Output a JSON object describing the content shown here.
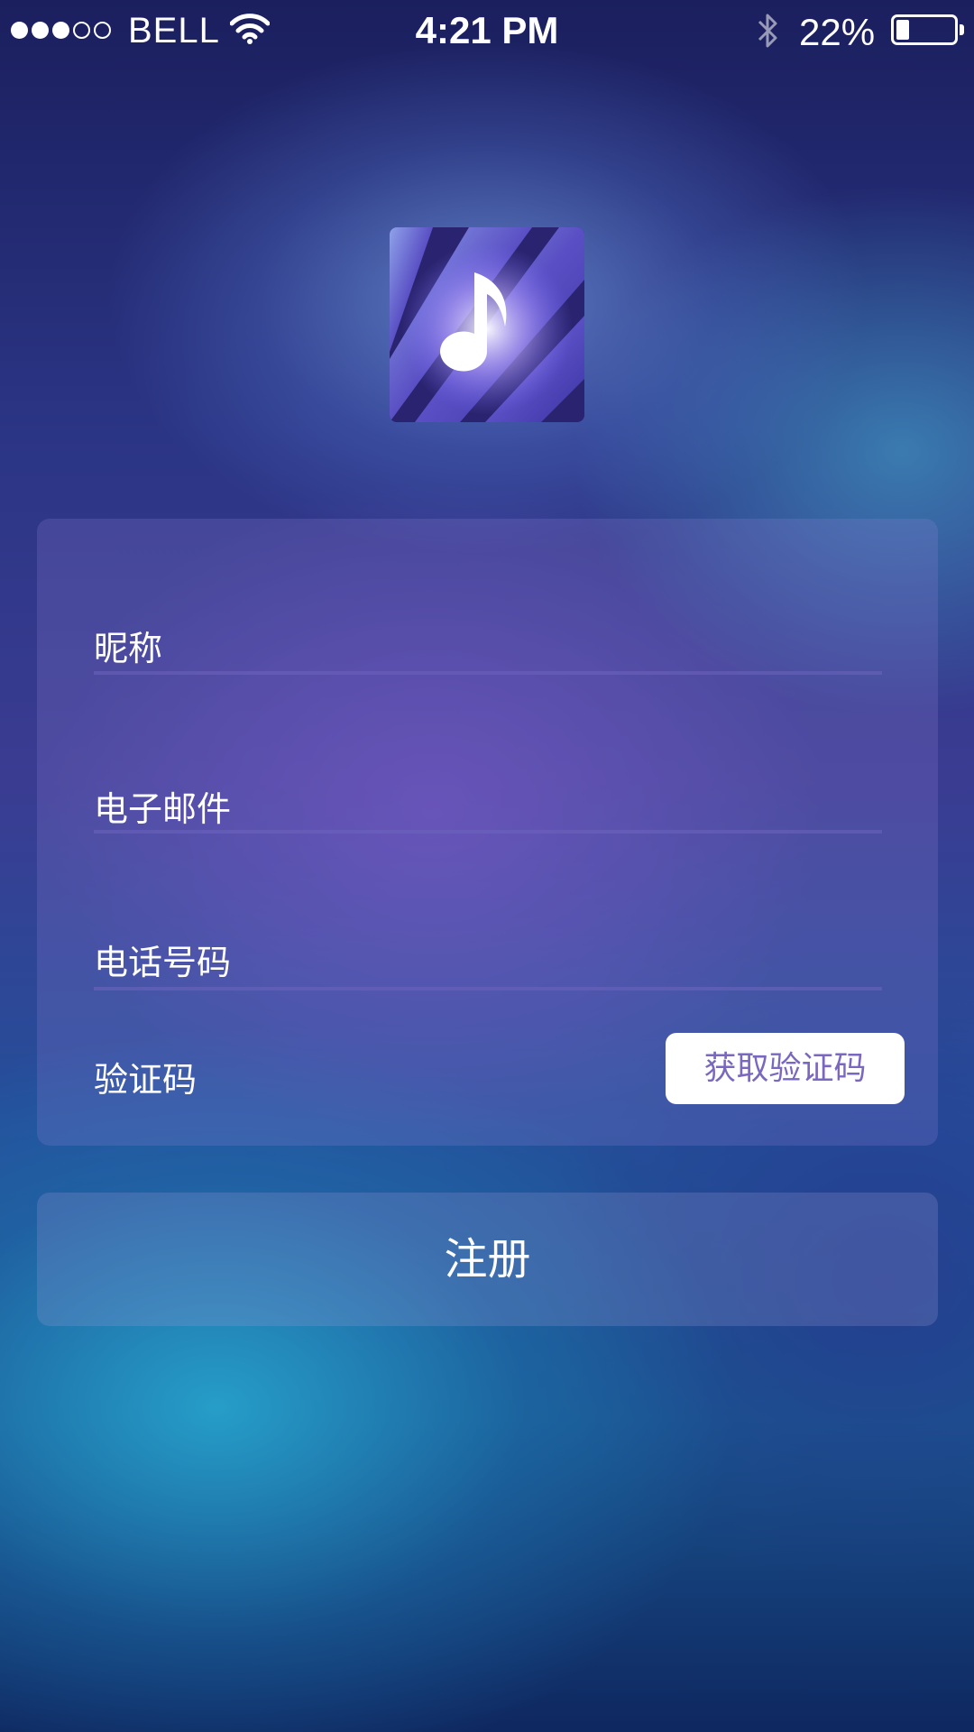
{
  "status_bar": {
    "carrier": "BELL",
    "signal_bars_filled": 3,
    "signal_bars_total": 5,
    "time": "4:21 PM",
    "battery_percent_text": "22%",
    "battery_level": 0.22,
    "wifi_icon": "wifi-icon",
    "bluetooth_icon": "bluetooth-icon"
  },
  "logo": {
    "icon": "music-note-icon"
  },
  "form": {
    "nickname_label": "昵称",
    "email_label": "电子邮件",
    "phone_label": "电话号码",
    "captcha_label": "验证码",
    "get_captcha_label": "获取验证码"
  },
  "register_label": "注册",
  "colors": {
    "accent_text": "#7a67c0",
    "button_bg": "#ffffff"
  }
}
